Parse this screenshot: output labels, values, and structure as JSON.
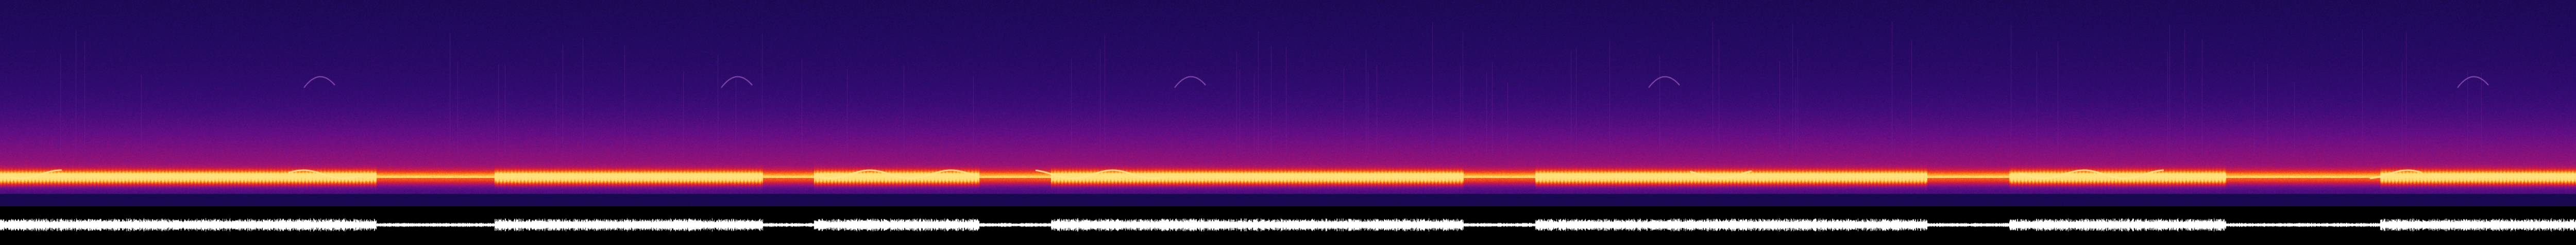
{
  "image": {
    "kind": "spectrogram-with-waveform",
    "colormap": [
      "#0a0626",
      "#1d0a5a",
      "#3a0c78",
      "#6a0f86",
      "#a01472",
      "#d21f3e",
      "#f24a1a",
      "#ff9a18",
      "#ffe07a"
    ],
    "background": "#000000",
    "waveform_color": "#ffffff"
  },
  "regions": {
    "spectrogram": {
      "description_free": true
    },
    "waveform": {
      "description_free": true
    }
  }
}
